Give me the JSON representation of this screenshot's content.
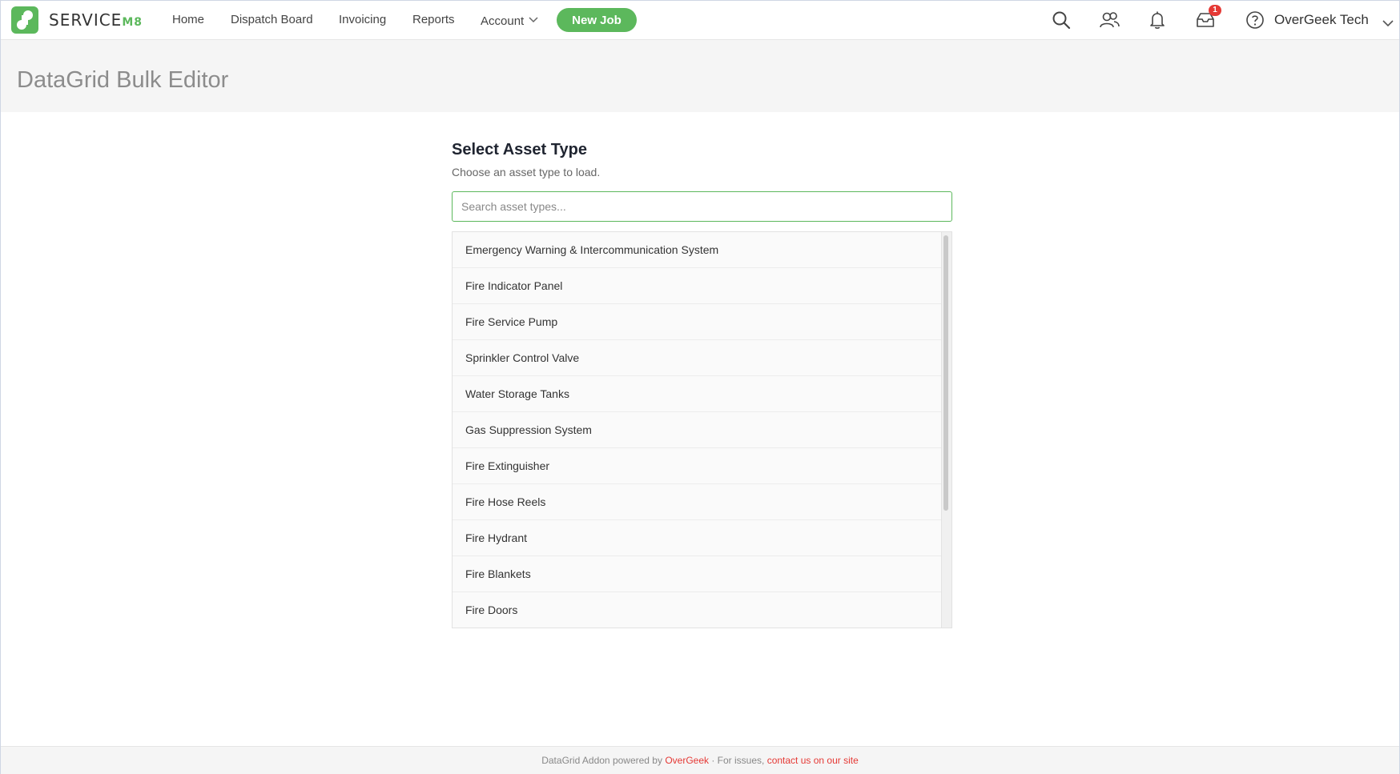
{
  "brand": {
    "name_prefix": "SERVICE",
    "name_suffix": "M8",
    "accent_color": "#5cb85c"
  },
  "nav": {
    "items": [
      "Home",
      "Dispatch Board",
      "Invoicing",
      "Reports",
      "Account"
    ],
    "new_job_label": "New Job"
  },
  "header_icons": [
    "search-icon",
    "people-icon",
    "bell-icon",
    "inbox-icon",
    "help-icon"
  ],
  "notifications": {
    "inbox_count": "1"
  },
  "account": {
    "name": "OverGeek Tech"
  },
  "page": {
    "title": "DataGrid Bulk Editor"
  },
  "selector": {
    "title": "Select Asset Type",
    "subtitle": "Choose an asset type to load.",
    "search_placeholder": "Search asset types...",
    "asset_types": [
      "Emergency Warning & Intercommunication System",
      "Fire Indicator Panel",
      "Fire Service Pump",
      "Sprinkler Control Valve",
      "Water Storage Tanks",
      "Gas Suppression System",
      "Fire Extinguisher",
      "Fire Hose Reels",
      "Fire Hydrant",
      "Fire Blankets",
      "Fire Doors"
    ]
  },
  "footer": {
    "prefix": "DataGrid Addon powered by ",
    "brand_link": "OverGeek",
    "middle": " · For issues, ",
    "contact_link": "contact us on our site"
  }
}
